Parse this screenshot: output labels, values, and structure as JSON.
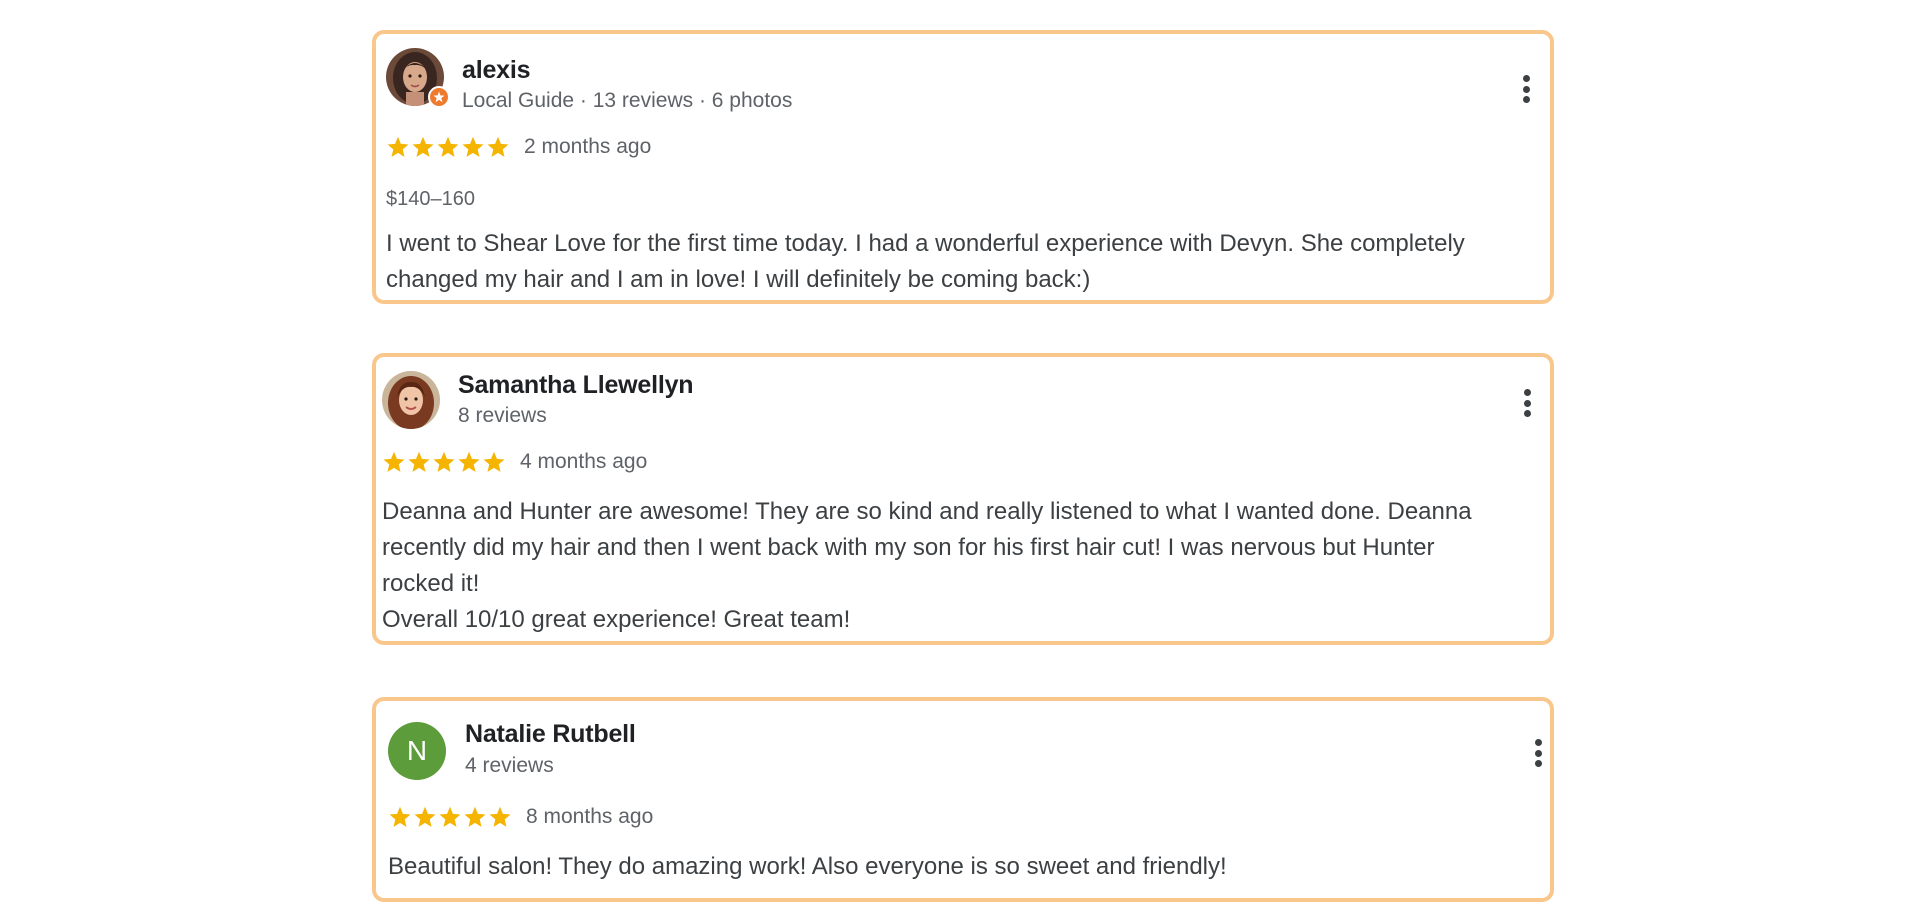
{
  "colors": {
    "card_border": "#f9c78c",
    "star": "#f4b400",
    "local_guide_badge": "#ee7b2d",
    "avatar_natalie": "#5c9c3a"
  },
  "reviews": [
    {
      "name": "alexis",
      "meta": "Local Guide · 13 reviews · 6 photos",
      "rating": 5,
      "date": "2 months ago",
      "price": "$140–160",
      "text": "I went to Shear Love for the first time today. I had a wonderful experience with Devyn. She completely\nchanged my hair and I am in love! I will definitely be coming back:)",
      "avatar_icon": "profile-photo",
      "badge_icon": "local-guide-star-icon",
      "menu_icon": "more-vert-icon"
    },
    {
      "name": "Samantha Llewellyn",
      "meta": "8 reviews",
      "rating": 5,
      "date": "4 months ago",
      "text": "Deanna and Hunter are awesome! They are so kind and really listened to what I wanted done. Deanna\nrecently did my hair and then I went back with my son for his first hair cut! I was nervous but Hunter\nrocked it!\nOverall 10/10 great experience! Great team!",
      "avatar_icon": "profile-photo",
      "menu_icon": "more-vert-icon"
    },
    {
      "name": "Natalie Rutbell",
      "meta": "4 reviews",
      "rating": 5,
      "date": "8 months ago",
      "avatar_letter": "N",
      "text": "Beautiful salon! They do amazing work! Also everyone is so sweet and friendly!",
      "menu_icon": "more-vert-icon"
    }
  ]
}
